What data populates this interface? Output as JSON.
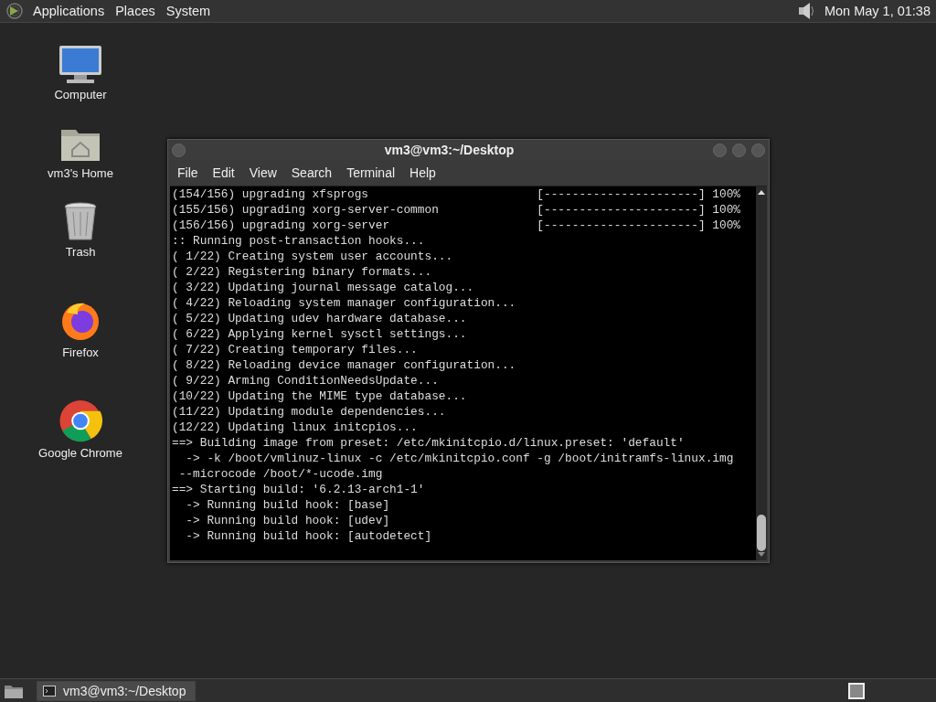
{
  "top_panel": {
    "menus": [
      "Applications",
      "Places",
      "System"
    ],
    "clock": "Mon May  1, 01:38"
  },
  "desktop_icons": [
    {
      "kind": "computer",
      "label": "Computer"
    },
    {
      "kind": "home",
      "label": "vm3's Home"
    },
    {
      "kind": "trash",
      "label": "Trash"
    },
    {
      "kind": "firefox",
      "label": "Firefox"
    },
    {
      "kind": "chrome",
      "label": "Google Chrome"
    }
  ],
  "window": {
    "title": "vm3@vm3:~/Desktop",
    "menu": [
      "File",
      "Edit",
      "View",
      "Search",
      "Terminal",
      "Help"
    ],
    "lines": [
      "(154/156) upgrading xfsprogs                        [----------------------] 100%",
      "(155/156) upgrading xorg-server-common              [----------------------] 100%",
      "(156/156) upgrading xorg-server                     [----------------------] 100%",
      ":: Running post-transaction hooks...",
      "( 1/22) Creating system user accounts...",
      "( 2/22) Registering binary formats...",
      "( 3/22) Updating journal message catalog...",
      "( 4/22) Reloading system manager configuration...",
      "( 5/22) Updating udev hardware database...",
      "( 6/22) Applying kernel sysctl settings...",
      "( 7/22) Creating temporary files...",
      "( 8/22) Reloading device manager configuration...",
      "( 9/22) Arming ConditionNeedsUpdate...",
      "(10/22) Updating the MIME type database...",
      "(11/22) Updating module dependencies...",
      "(12/22) Updating linux initcpios...",
      "==> Building image from preset: /etc/mkinitcpio.d/linux.preset: 'default'",
      "  -> -k /boot/vmlinuz-linux -c /etc/mkinitcpio.conf -g /boot/initramfs-linux.img",
      " --microcode /boot/*-ucode.img",
      "==> Starting build: '6.2.13-arch1-1'",
      "  -> Running build hook: [base]",
      "  -> Running build hook: [udev]",
      "  -> Running build hook: [autodetect]"
    ]
  },
  "taskbar": {
    "tasks": [
      {
        "label": "vm3@vm3:~/Desktop",
        "selected": true
      }
    ]
  }
}
